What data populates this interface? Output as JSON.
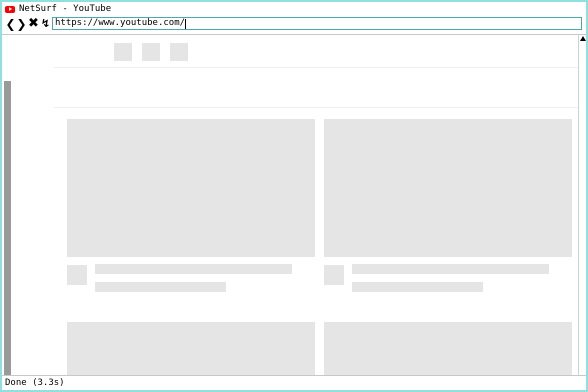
{
  "window": {
    "title": "NetSurf - YouTube",
    "favicon": "youtube-icon"
  },
  "toolbar": {
    "back_icon": "back-icon",
    "forward_icon": "forward-icon",
    "stop_icon": "stop-icon",
    "reload_icon": "reload-icon",
    "back_glyph": "❮",
    "forward_glyph": "❯",
    "stop_glyph": "✖",
    "reload_glyph": "↯",
    "url": "https://www.youtube.com/"
  },
  "status": {
    "text": "Done (3.3s)"
  },
  "colors": {
    "window_border": "#8fe0e0",
    "url_border": "#4aa9a9",
    "placeholder": "#e5e5e5",
    "scroll_thumb": "#9a9a9a"
  }
}
